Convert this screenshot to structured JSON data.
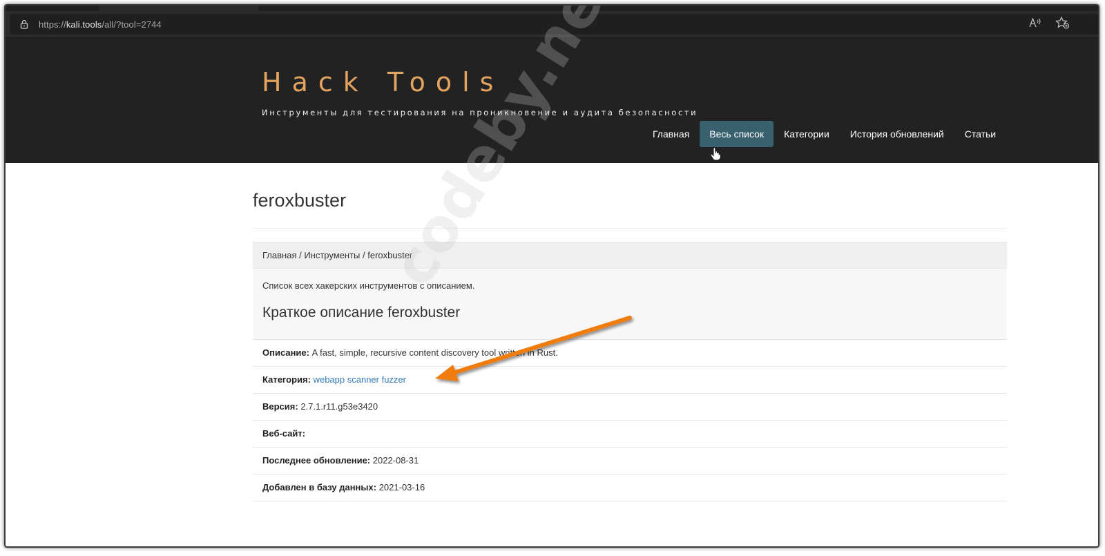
{
  "browser": {
    "url_scheme": "https://",
    "url_host": "kali.tools",
    "url_path": "/all/?tool=2744",
    "read_aloud_icon": "A",
    "favorite_icon": "☆"
  },
  "site": {
    "title": "Hack Tools",
    "subtitle": "Инструменты для тестирования на проникновение и аудита безопасности",
    "nav": [
      {
        "label": "Главная",
        "active": false
      },
      {
        "label": "Весь список",
        "active": true
      },
      {
        "label": "Категории",
        "active": false
      },
      {
        "label": "История обновлений",
        "active": false
      },
      {
        "label": "Статьи",
        "active": false
      }
    ]
  },
  "page": {
    "title": "feroxbuster",
    "breadcrumb": [
      "Главная",
      "Инструменты",
      "feroxbuster"
    ],
    "breadcrumb_separator": " / ",
    "intro_text": "Список всех хакерских инструментов с описанием.",
    "heading": "Краткое описание feroxbuster",
    "info": [
      {
        "label": "Описание:",
        "value": "A fast, simple, recursive content discovery tool written in Rust."
      },
      {
        "label": "Категория:",
        "value": "webapp scanner fuzzer",
        "link": true
      },
      {
        "label": "Версия:",
        "value": "2.7.1.r11.g53e3420"
      },
      {
        "label": "Веб-сайт:",
        "value": ""
      },
      {
        "label": "Последнее обновление:",
        "value": "2022-08-31"
      },
      {
        "label": "Добавлен в базу данных:",
        "value": "2021-03-16"
      }
    ]
  },
  "overlays": {
    "watermark": "codeby.net",
    "arrow_color": "#f07c0c"
  }
}
